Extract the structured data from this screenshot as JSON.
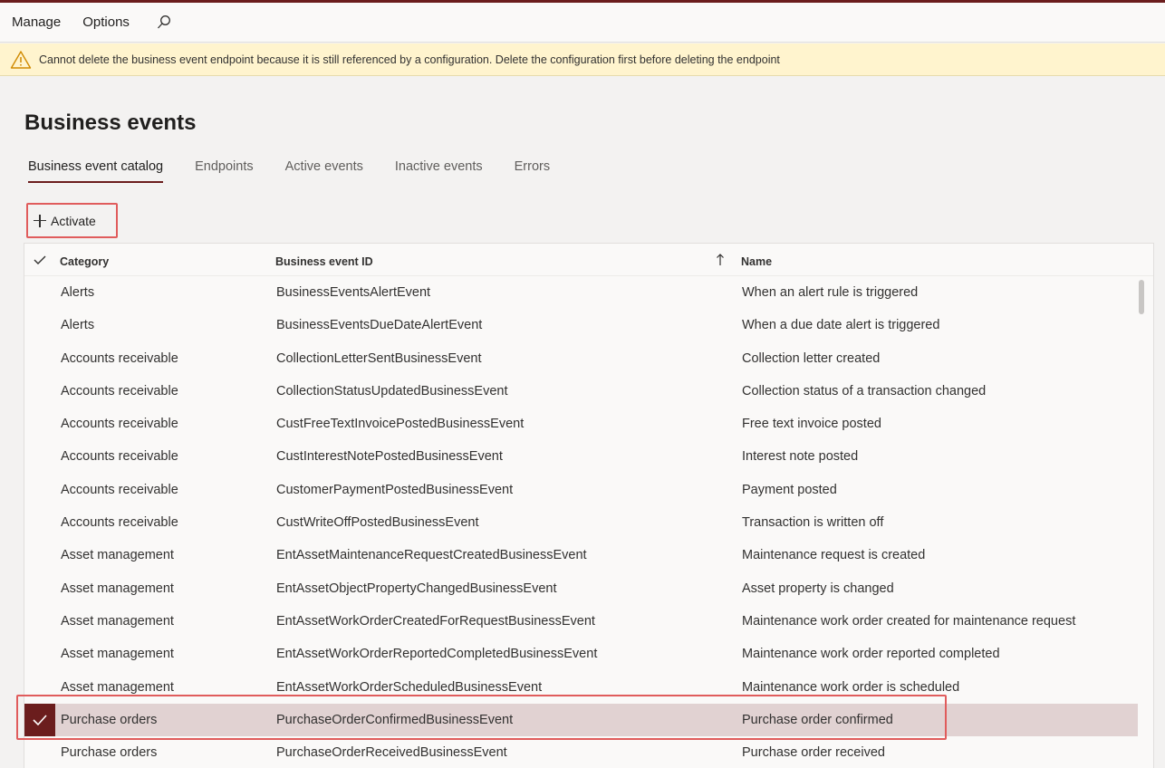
{
  "commandbar": {
    "items": [
      "Manage",
      "Options"
    ]
  },
  "warning": {
    "text": "Cannot delete the business event endpoint because it is still referenced by a configuration. Delete the configuration first before deleting the endpoint"
  },
  "page": {
    "title": "Business events"
  },
  "tabs": [
    "Business event catalog",
    "Endpoints",
    "Active events",
    "Inactive events",
    "Errors"
  ],
  "toolbar": {
    "activate_label": "Activate"
  },
  "grid": {
    "columns": [
      "Category",
      "Business event ID",
      "Name"
    ],
    "sort_column": "Business event ID",
    "selected_row_index": 13,
    "rows": [
      [
        "Alerts",
        "BusinessEventsAlertEvent",
        "When an alert rule is triggered"
      ],
      [
        "Alerts",
        "BusinessEventsDueDateAlertEvent",
        "When a due date alert is triggered"
      ],
      [
        "Accounts receivable",
        "CollectionLetterSentBusinessEvent",
        "Collection letter created"
      ],
      [
        "Accounts receivable",
        "CollectionStatusUpdatedBusinessEvent",
        "Collection status of a transaction changed"
      ],
      [
        "Accounts receivable",
        "CustFreeTextInvoicePostedBusinessEvent",
        "Free text invoice posted"
      ],
      [
        "Accounts receivable",
        "CustInterestNotePostedBusinessEvent",
        "Interest note posted"
      ],
      [
        "Accounts receivable",
        "CustomerPaymentPostedBusinessEvent",
        "Payment posted"
      ],
      [
        "Accounts receivable",
        "CustWriteOffPostedBusinessEvent",
        "Transaction is written off"
      ],
      [
        "Asset management",
        "EntAssetMaintenanceRequestCreatedBusinessEvent",
        "Maintenance request is created"
      ],
      [
        "Asset management",
        "EntAssetObjectPropertyChangedBusinessEvent",
        "Asset property is changed"
      ],
      [
        "Asset management",
        "EntAssetWorkOrderCreatedForRequestBusinessEvent",
        "Maintenance work order created for maintenance request"
      ],
      [
        "Asset management",
        "EntAssetWorkOrderReportedCompletedBusinessEvent",
        "Maintenance work order reported completed"
      ],
      [
        "Asset management",
        "EntAssetWorkOrderScheduledBusinessEvent",
        "Maintenance work order is scheduled"
      ],
      [
        "Purchase orders",
        "PurchaseOrderConfirmedBusinessEvent",
        "Purchase order confirmed"
      ],
      [
        "Purchase orders",
        "PurchaseOrderReceivedBusinessEvent",
        "Purchase order received"
      ]
    ]
  },
  "colors": {
    "accent": "#6b1d1d",
    "selected_row": "#e1d2d2",
    "highlight": "#e05c5c",
    "warning_bg": "#fff4ce"
  }
}
